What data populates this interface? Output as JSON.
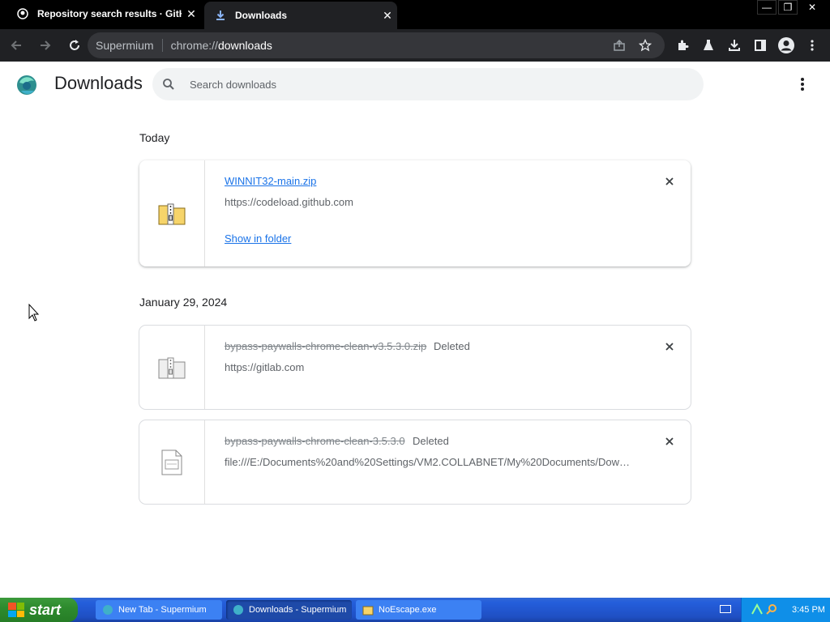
{
  "browser": {
    "tabs": [
      {
        "title": "Repository search results · GitHub",
        "close": "✕",
        "active": false
      },
      {
        "title": "Downloads",
        "close": "✕",
        "active": true
      }
    ],
    "window_controls": [
      "—",
      "❐",
      "✕"
    ],
    "omnibox": {
      "site": "Supermium",
      "url_prefix": "chrome://",
      "url_host": "downloads"
    }
  },
  "page": {
    "title": "Downloads",
    "search_placeholder": "Search downloads",
    "groups": [
      {
        "date": "Today",
        "items": [
          {
            "filename": "WINNIT32-main.zip",
            "status": "",
            "source": "https://codeload.github.com",
            "action": "Show in folder",
            "deleted": false,
            "icon": "zip-folder-icon"
          }
        ]
      },
      {
        "date": "January 29, 2024",
        "items": [
          {
            "filename": "bypass-paywalls-chrome-clean-v3.5.3.0.zip",
            "status": "Deleted",
            "source": "https://gitlab.com",
            "deleted": true,
            "icon": "zip-folder-icon"
          },
          {
            "filename": "bypass-paywalls-chrome-clean-3.5.3.0",
            "status": "Deleted",
            "source": "file:///E:/Documents%20and%20Settings/VM2.COLLABNET/My%20Documents/Down...",
            "deleted": true,
            "icon": "file-icon"
          }
        ]
      }
    ]
  },
  "taskbar": {
    "start_label": "start",
    "tasks": [
      {
        "label": "New Tab - Supermium",
        "active": false
      },
      {
        "label": "Downloads - Supermium",
        "active": true
      },
      {
        "label": "NoEscape.exe",
        "active": false
      }
    ],
    "clock": "3:45 PM"
  },
  "colors": {
    "link": "#1a73e8",
    "toolbar": "#202124",
    "taskbar": "#245edb",
    "start": "#2e8b2e"
  }
}
